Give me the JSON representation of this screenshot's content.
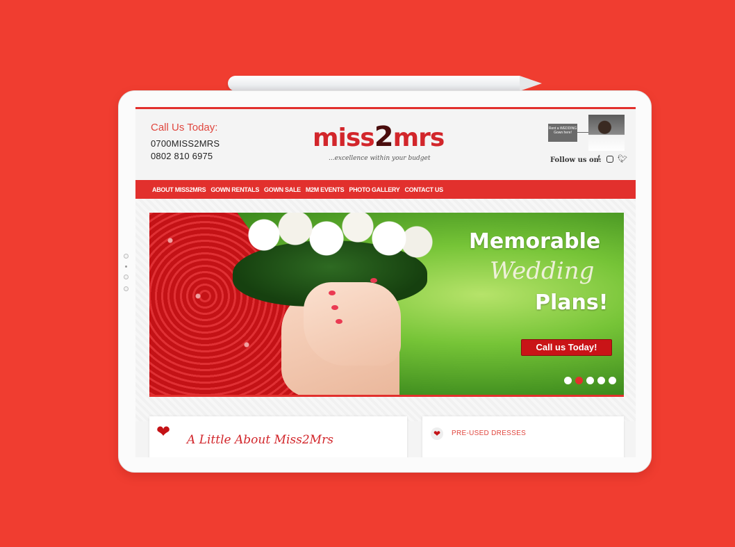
{
  "colors": {
    "background": "#f03d30",
    "brand_red": "#e2302d",
    "button_red": "#c91417"
  },
  "header": {
    "call_title": "Call Us Today:",
    "phone_primary": "0700MISS2MRS",
    "phone_secondary": "0802 810 6975",
    "logo_prefix": "miss",
    "logo_number": "2",
    "logo_suffix": "mrs",
    "tagline": "...excellence within your budget",
    "rent_badge": "Rent a WEDDING Gown here!",
    "follow_label": "Follow us on:",
    "social_icons": [
      "facebook-icon",
      "instagram-icon",
      "twitter-icon"
    ]
  },
  "nav": {
    "items": [
      {
        "label": "ABOUT MISS2MRS"
      },
      {
        "label": "GOWN RENTALS"
      },
      {
        "label": "GOWN SALE"
      },
      {
        "label": "M2M EVENTS"
      },
      {
        "label": "PHOTO GALLERY"
      },
      {
        "label": "CONTACT US"
      }
    ]
  },
  "slider": {
    "line1": "Memorable",
    "line2": "Wedding",
    "line3": "Plans!",
    "button_label": "Call us Today!",
    "dot_count": 5,
    "active_dot": 2
  },
  "cards": {
    "left_title": "A Little About Miss2Mrs",
    "right_title": "PRE-USED DRESSES"
  }
}
